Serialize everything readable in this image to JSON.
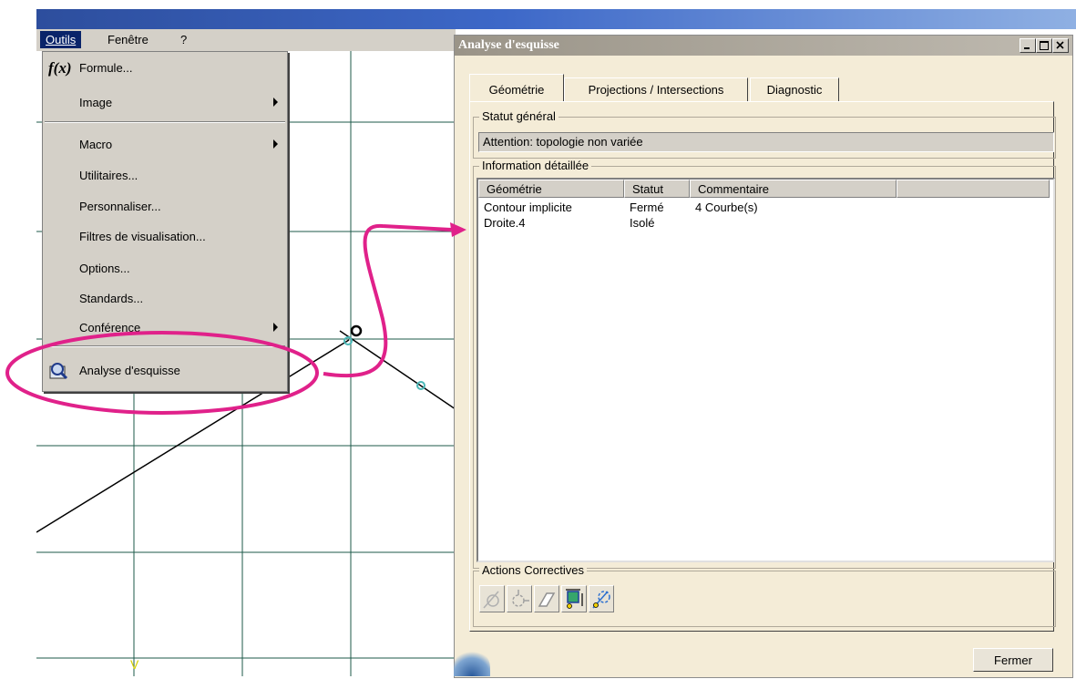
{
  "menubar": {
    "outils": "Outils",
    "fenetre": "Fenêtre",
    "help": "?"
  },
  "menu": {
    "items": [
      {
        "label": "Formule...",
        "icon": "formula-fx-icon",
        "submenu": false
      },
      {
        "label": "Image",
        "submenu": true
      },
      {
        "label": "Macro",
        "submenu": true
      },
      {
        "label": "Utilitaires...",
        "submenu": false
      },
      {
        "label": "Personnaliser...",
        "submenu": false
      },
      {
        "label": "Filtres de visualisation...",
        "submenu": false
      },
      {
        "label": "Options...",
        "submenu": false
      },
      {
        "label": "Standards...",
        "submenu": false
      },
      {
        "label": "Conférence",
        "submenu": true
      },
      {
        "label": "Analyse d'esquisse",
        "icon": "sketch-analysis-icon",
        "submenu": false
      }
    ],
    "fx_icon_text": "f(x)"
  },
  "dialog": {
    "title": "Analyse d'esquisse",
    "tabs": [
      "Géométrie",
      "Projections / Intersections",
      "Diagnostic"
    ],
    "active_tab": "Géométrie",
    "general_status": {
      "label": "Statut général",
      "value": "Attention: topologie non variée"
    },
    "detail": {
      "label": "Information détaillée",
      "columns": [
        "Géométrie",
        "Statut",
        "Commentaire"
      ],
      "rows": [
        [
          "Contour implicite",
          "Fermé",
          "4 Courbe(s)"
        ],
        [
          "Droite.4",
          "Isolé",
          ""
        ]
      ]
    },
    "corrective": {
      "label": "Actions Correctives",
      "buttons": [
        "hide-constraints-icon",
        "rotate-icon",
        "erase-icon",
        "measure-icon",
        "construction-icon"
      ]
    },
    "close_button": "Fermer"
  },
  "colors": {
    "menu_bg": "#d4d0c8",
    "menu_highlight": "#0a246a",
    "dialog_bg": "#f4ecd7",
    "annotation": "#e0218a",
    "grid": "#1e5a4a"
  }
}
